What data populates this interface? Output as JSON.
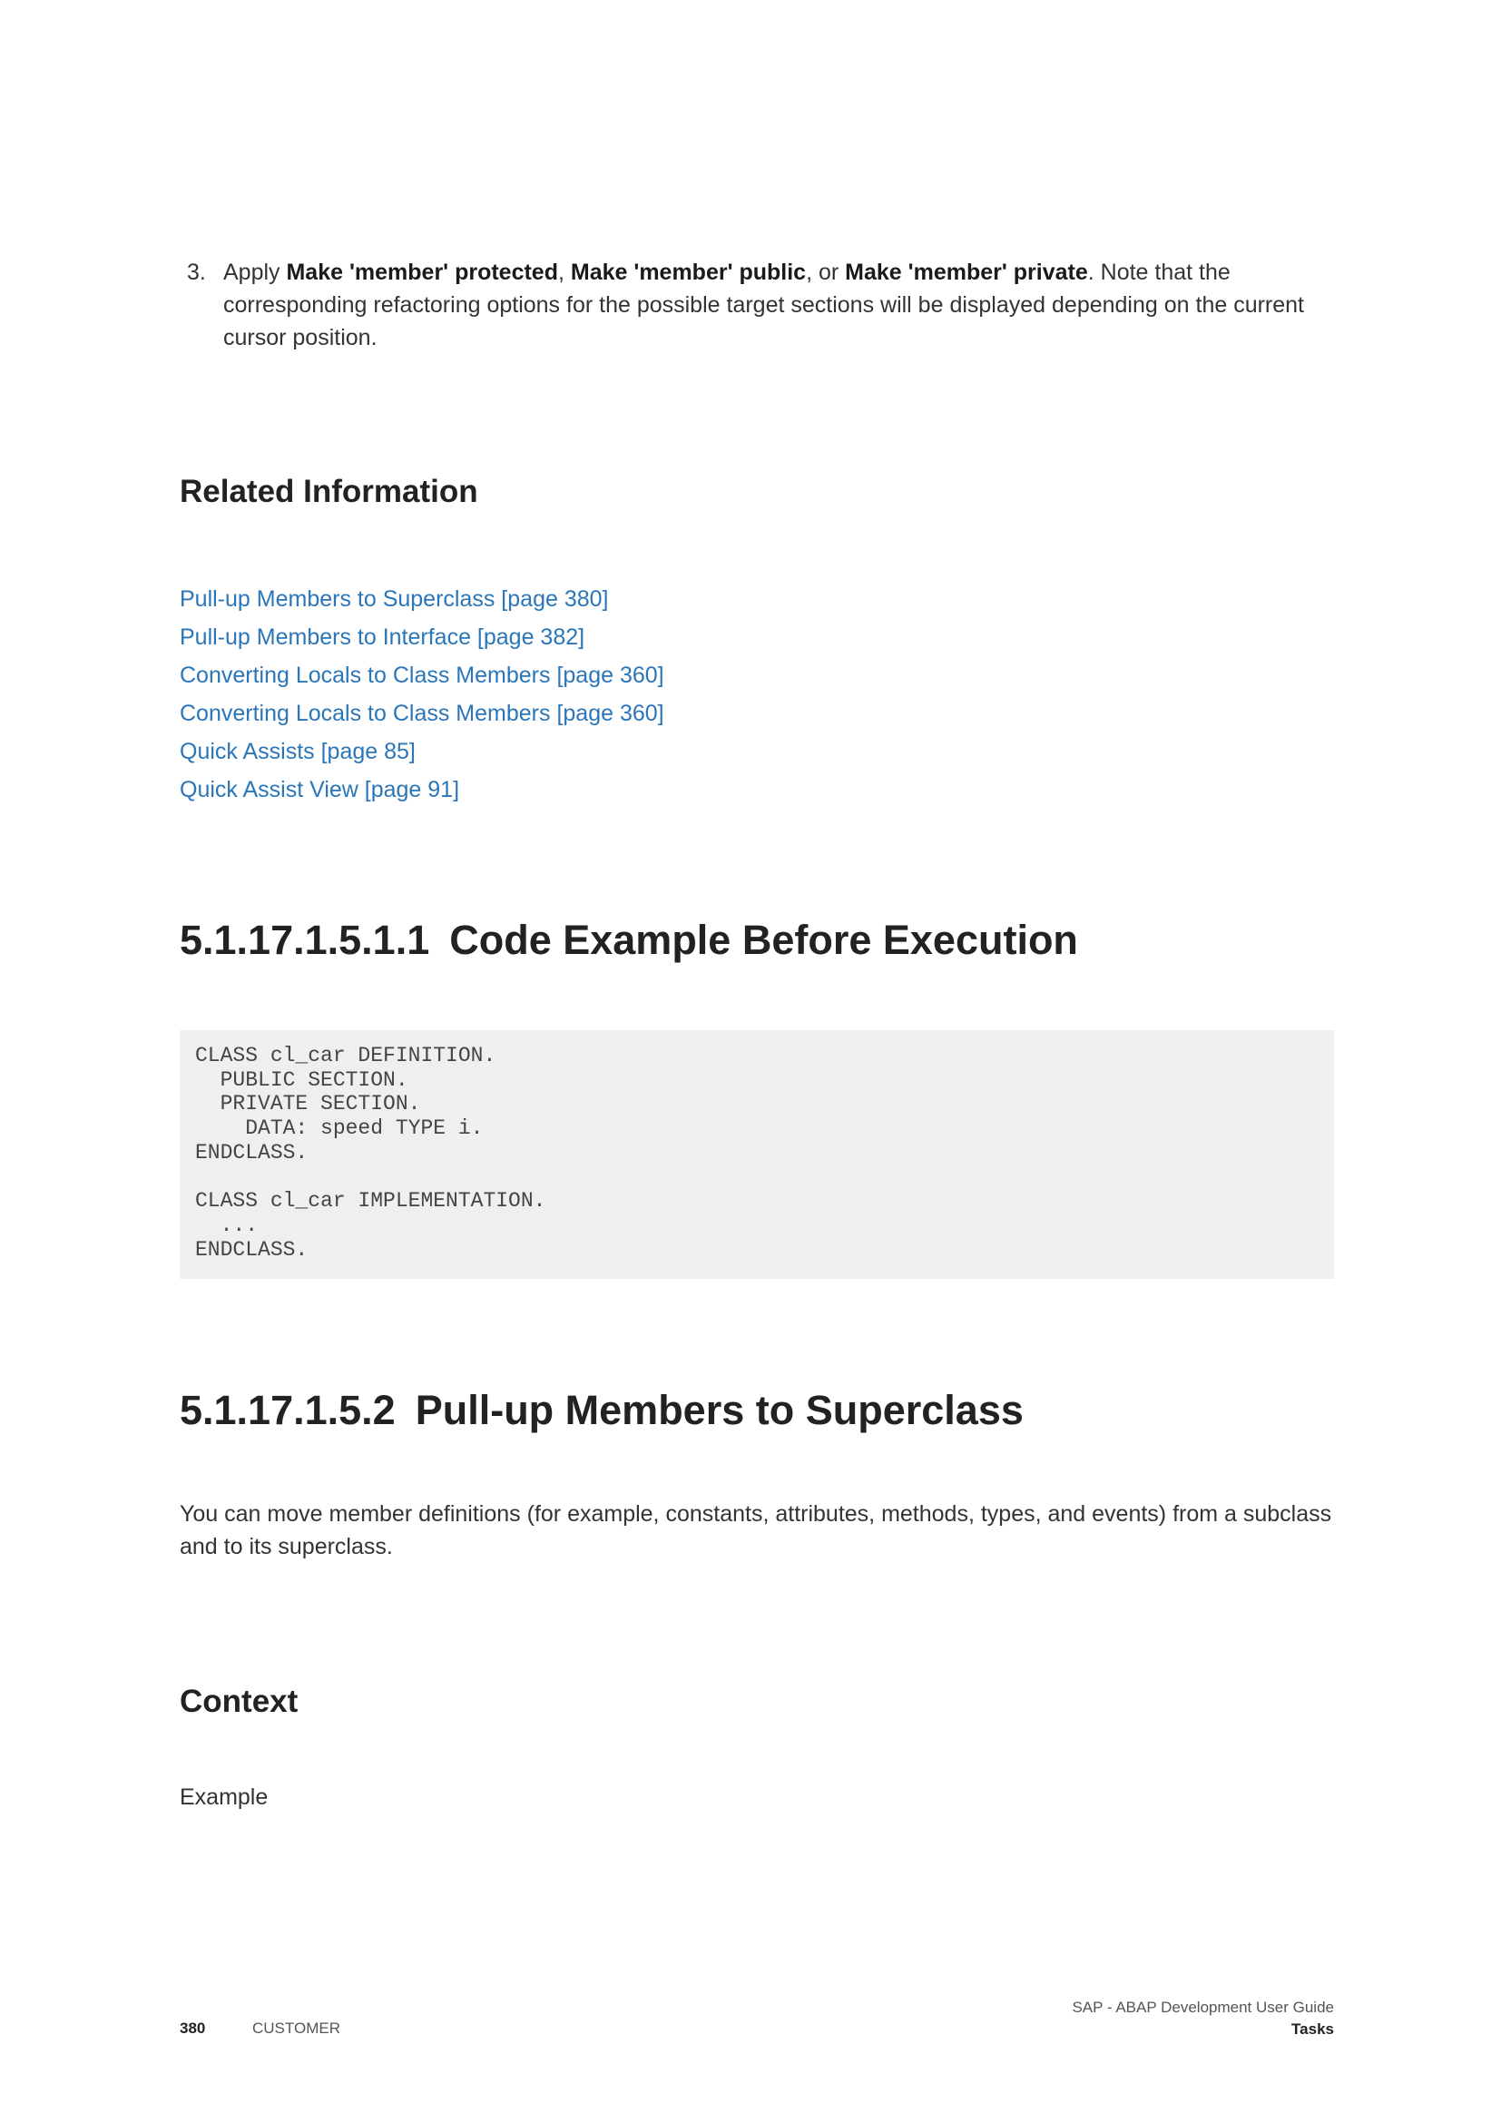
{
  "step": {
    "number": "3.",
    "text_before": "Apply ",
    "option_protected": "Make 'member' protected",
    "sep1": ", ",
    "option_public": "Make 'member' public",
    "sep2": ", or ",
    "option_private": "Make 'member' private",
    "text_after": ". Note that the corresponding refactoring options for the possible target sections will be displayed depending on the current cursor position."
  },
  "related": {
    "heading": "Related Information",
    "links": [
      "Pull-up Members to Superclass [page 380]",
      "Pull-up Members to Interface [page 382]",
      "Converting Locals to Class Members [page 360]",
      "Converting Locals to Class Members [page 360]",
      "Quick Assists [page 85]",
      "Quick Assist View [page 91]"
    ]
  },
  "section1": {
    "number": "5.1.17.1.5.1.1",
    "title": "Code Example Before Execution"
  },
  "code_example": "CLASS cl_car DEFINITION.\n  PUBLIC SECTION.\n  PRIVATE SECTION.\n    DATA: speed TYPE i.\nENDCLASS.\n\nCLASS cl_car IMPLEMENTATION.\n  ...\nENDCLASS.",
  "section2": {
    "number": "5.1.17.1.5.2",
    "title": "Pull-up Members to Superclass",
    "intro": "You can move member definitions (for example, constants, attributes, methods, types, and events) from a subclass and to its superclass."
  },
  "context": {
    "heading": "Context",
    "example_label": "Example"
  },
  "footer": {
    "page_number": "380",
    "classification": "CUSTOMER",
    "doc_title": "SAP - ABAP Development User Guide",
    "section_name": "Tasks"
  },
  "colors": {
    "link": "#2a76b8",
    "code_background": "#efefef",
    "heading": "#222222",
    "body_text": "#333333"
  }
}
